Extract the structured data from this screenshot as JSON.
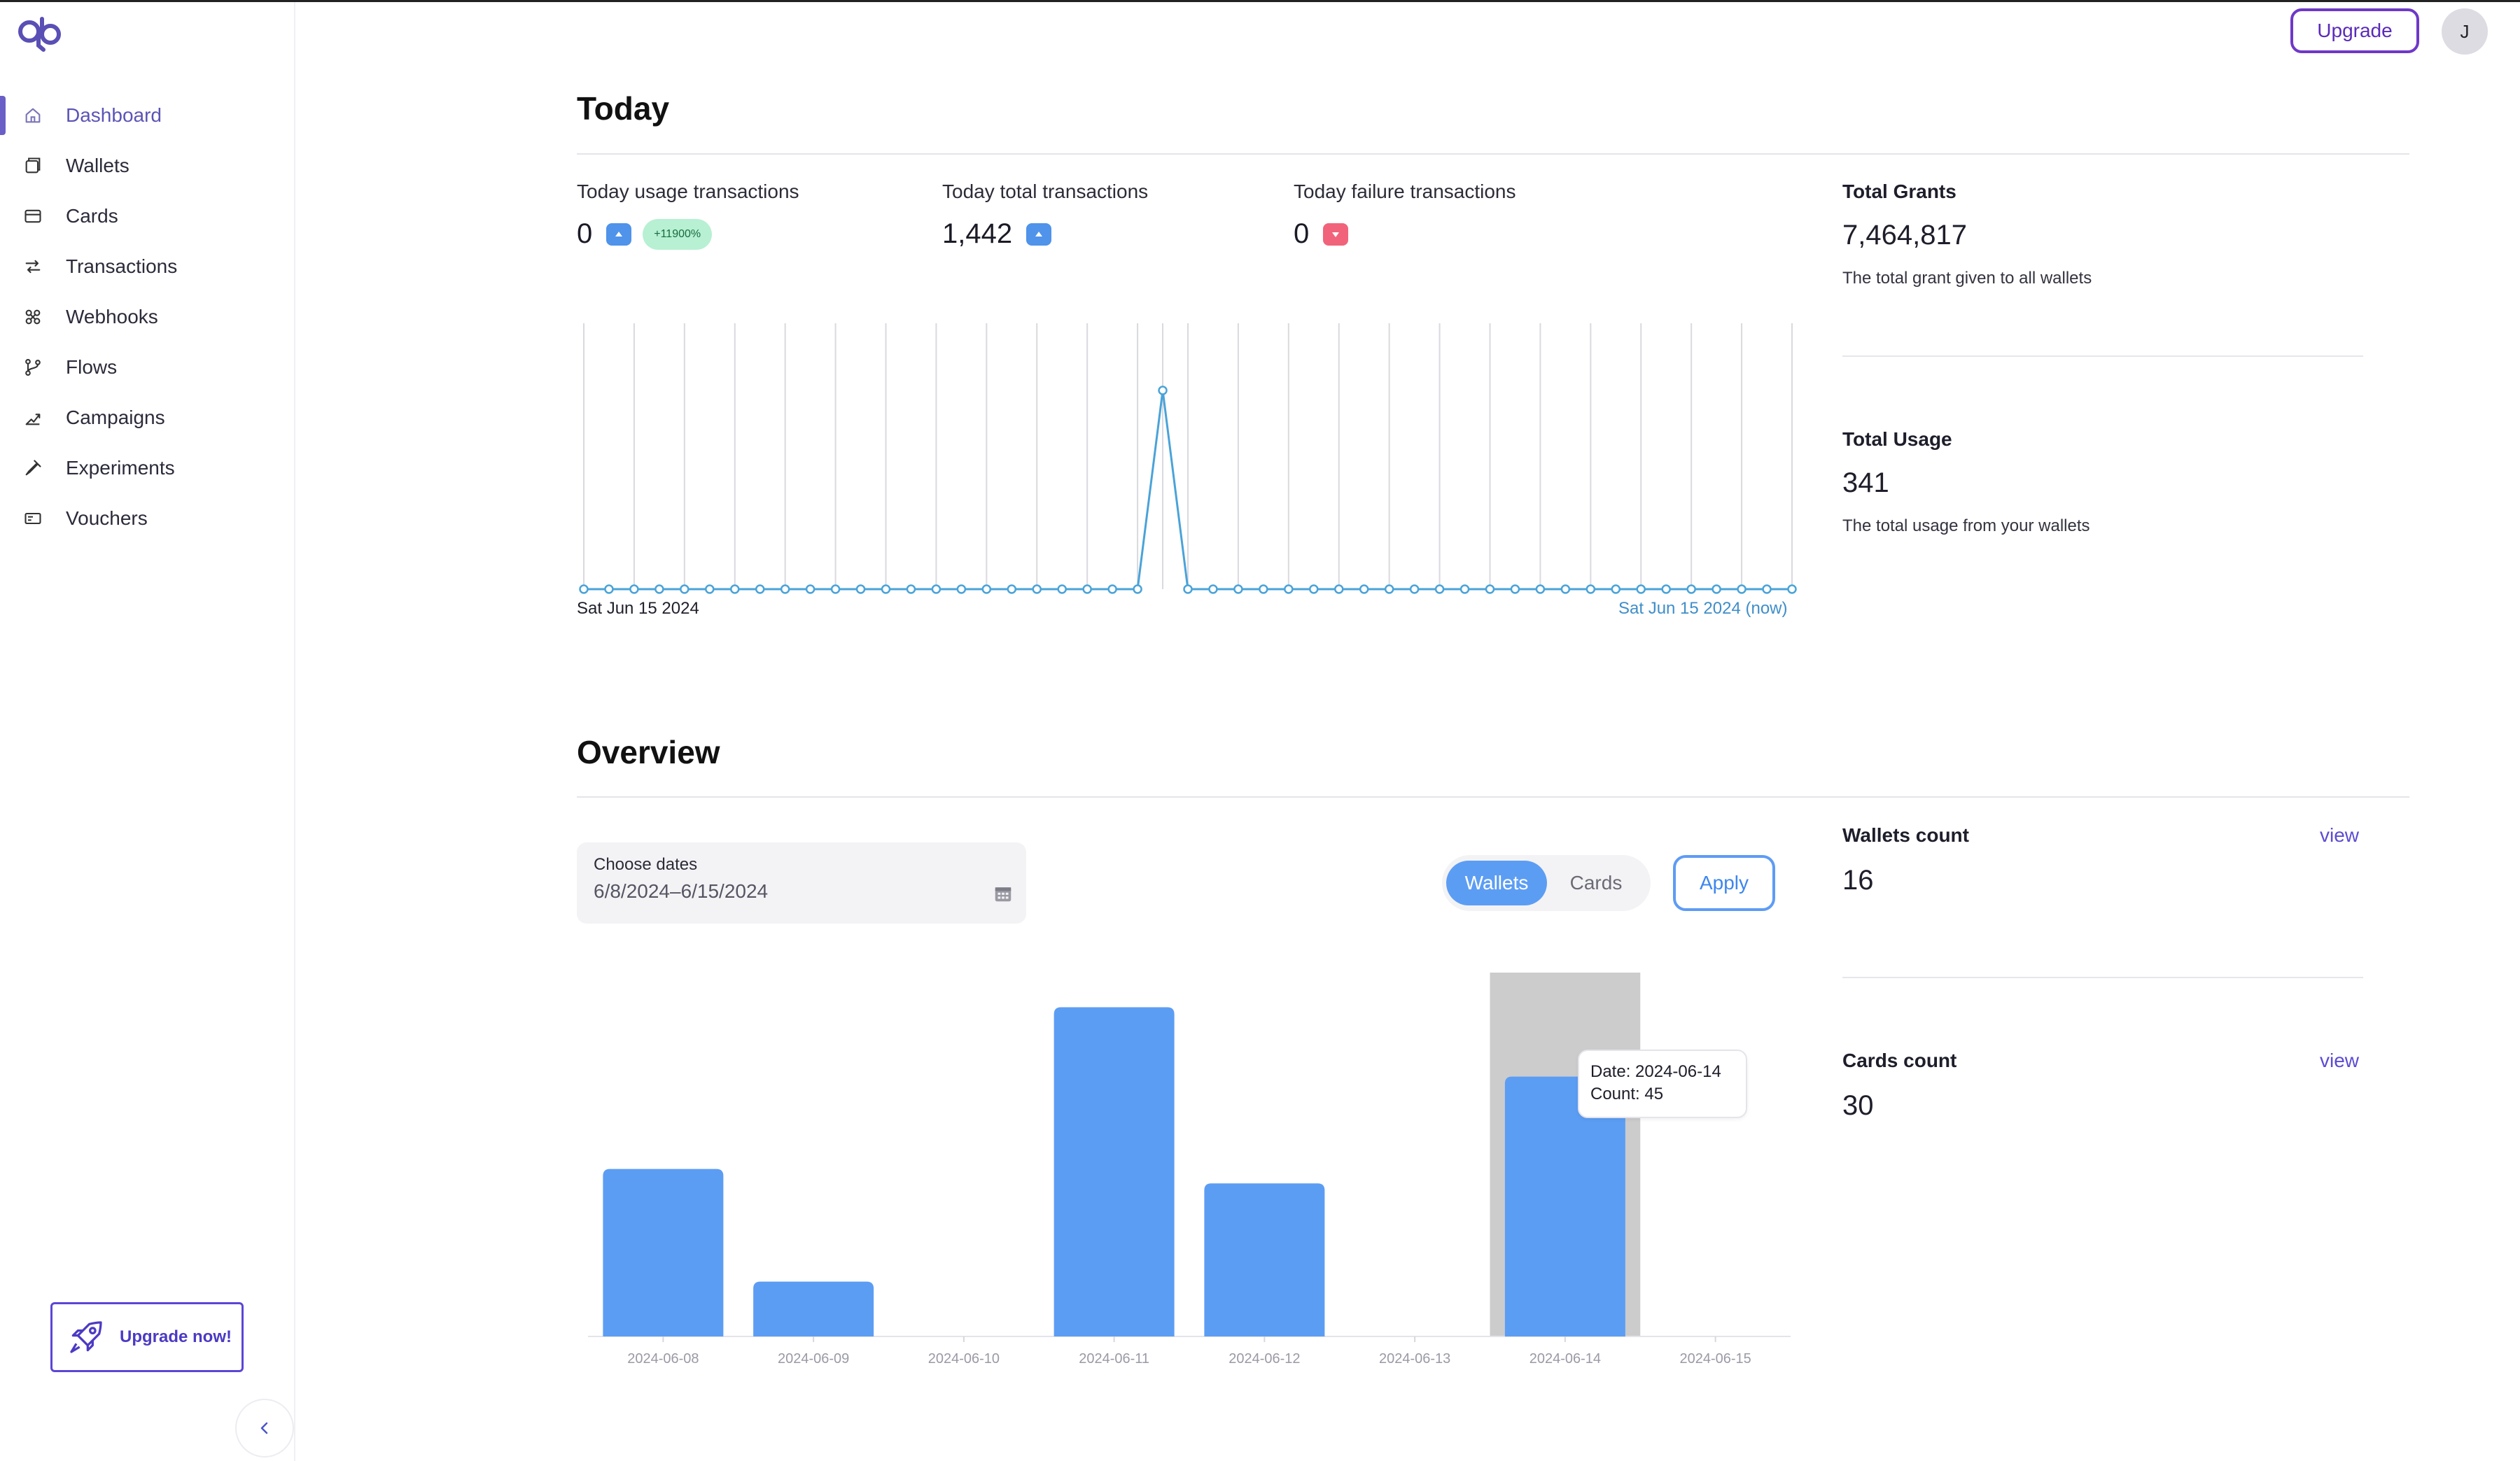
{
  "header": {
    "upgrade_label": "Upgrade",
    "avatar_initial": "J"
  },
  "sidebar": {
    "items": [
      {
        "label": "Dashboard",
        "icon": "home-icon"
      },
      {
        "label": "Wallets",
        "icon": "wallet-icon"
      },
      {
        "label": "Cards",
        "icon": "card-icon"
      },
      {
        "label": "Transactions",
        "icon": "transfer-icon"
      },
      {
        "label": "Webhooks",
        "icon": "webhook-icon"
      },
      {
        "label": "Flows",
        "icon": "flow-icon"
      },
      {
        "label": "Campaigns",
        "icon": "campaign-icon"
      },
      {
        "label": "Experiments",
        "icon": "experiment-icon"
      },
      {
        "label": "Vouchers",
        "icon": "voucher-icon"
      }
    ],
    "active": "Dashboard",
    "upgrade_now_label": "Upgrade now!"
  },
  "today": {
    "title": "Today",
    "usage": {
      "label": "Today usage transactions",
      "value": "0",
      "change": "+11900%"
    },
    "total": {
      "label": "Today total transactions",
      "value": "1,442"
    },
    "failure": {
      "label": "Today failure transactions",
      "value": "0"
    },
    "grants": {
      "label": "Total Grants",
      "value": "7,464,817",
      "desc": "The total grant given to all wallets"
    },
    "usage_total": {
      "label": "Total Usage",
      "value": "341",
      "desc": "The total usage from your wallets"
    },
    "chart_start_label": "Sat Jun 15 2024",
    "chart_end_label": "Sat Jun 15 2024 (now)"
  },
  "overview": {
    "title": "Overview",
    "date_caption": "Choose dates",
    "date_value": "6/8/2024–6/15/2024",
    "toggle": {
      "wallets": "Wallets",
      "cards": "Cards",
      "selected": "Wallets"
    },
    "apply_label": "Apply",
    "wallets_count": {
      "label": "Wallets count",
      "value": "16",
      "link": "view"
    },
    "cards_count": {
      "label": "Cards count",
      "value": "30",
      "link": "view"
    },
    "tooltip": {
      "date": "Date: 2024-06-14",
      "count": "Count: 45"
    }
  },
  "colors": {
    "accent": "#6a5fc7",
    "bar": "#5c9df4",
    "line": "#4aa3d8",
    "hover_band": "#cccccc"
  },
  "chart_data": [
    {
      "type": "line",
      "xlabel": "",
      "ylabel": "",
      "x_start": "Sat Jun 15 2024",
      "x_end": "Sat Jun 15 2024 (now)",
      "values": [
        0,
        0,
        0,
        0,
        0,
        0,
        0,
        0,
        0,
        0,
        0,
        0,
        0,
        0,
        0,
        0,
        0,
        0,
        0,
        0,
        0,
        0,
        0,
        1,
        0,
        0,
        0,
        0,
        0,
        0,
        0,
        0,
        0,
        0,
        0,
        0,
        0,
        0,
        0,
        0,
        0,
        0,
        0,
        0,
        0,
        0,
        0,
        0,
        0
      ],
      "grid": true
    },
    {
      "type": "bar",
      "categories": [
        "2024-06-08",
        "2024-06-09",
        "2024-06-10",
        "2024-06-11",
        "2024-06-12",
        "2024-06-13",
        "2024-06-14",
        "2024-06-15"
      ],
      "values": [
        29,
        9.5,
        0,
        57,
        26.5,
        0,
        45,
        0
      ],
      "highlighted": "2024-06-14",
      "ylim": [
        0,
        63
      ],
      "xlabel": "",
      "ylabel": ""
    }
  ]
}
